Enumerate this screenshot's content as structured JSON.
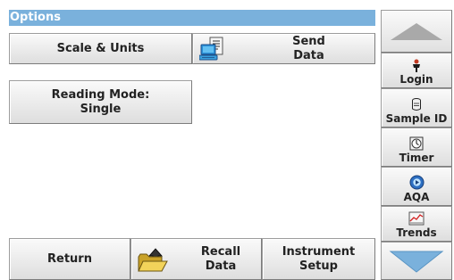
{
  "screen": {
    "title": "Options"
  },
  "buttons": {
    "scale_units": "Scale & Units",
    "send_data": "Send\nData",
    "reading_mode": "Reading Mode:\nSingle",
    "return": "Return",
    "recall_data": "Recall\nData",
    "instrument_setup": "Instrument\nSetup"
  },
  "sidebar": {
    "scroll_up": "scroll-up",
    "items": [
      {
        "label": "Login",
        "icon": "login-person-icon"
      },
      {
        "label": "Sample ID",
        "icon": "sample-id-icon"
      },
      {
        "label": "Timer",
        "icon": "timer-icon"
      },
      {
        "label": "AQA",
        "icon": "aqa-icon"
      },
      {
        "label": "Trends",
        "icon": "trends-icon"
      }
    ],
    "scroll_down": "scroll-down"
  },
  "colors": {
    "title_bar": "#7ab1dc",
    "arrow": "#7ab1dc",
    "button_face": "#e8e8e8"
  }
}
